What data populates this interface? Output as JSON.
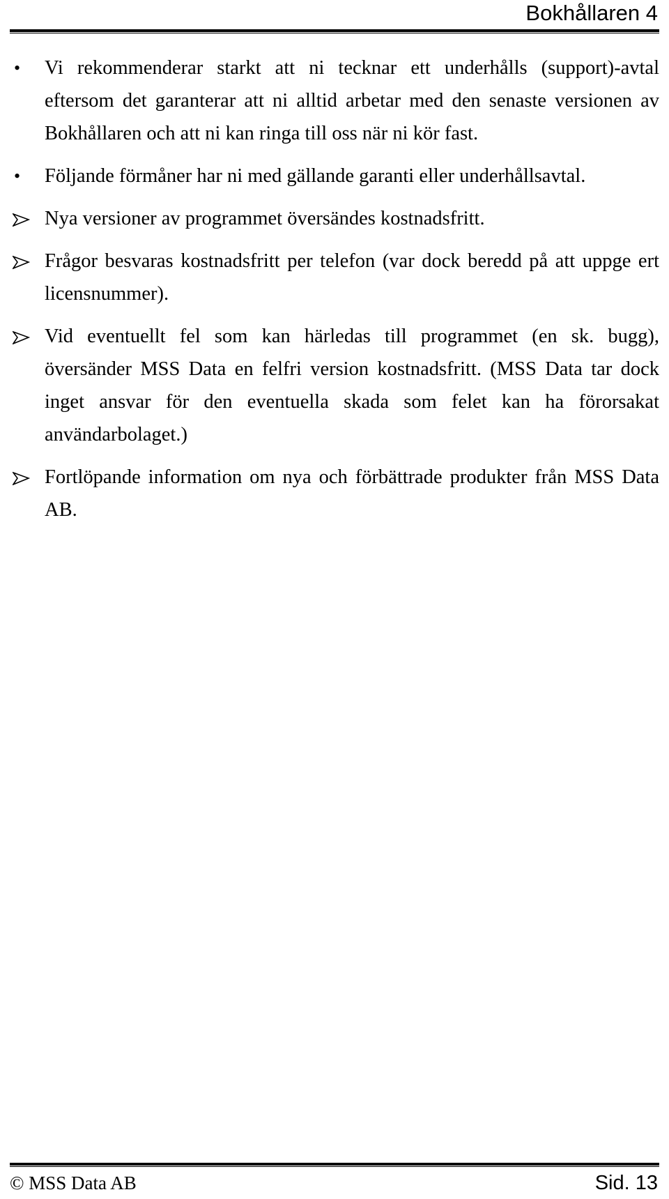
{
  "header": {
    "title": "Bokhållaren 4"
  },
  "content": {
    "items": [
      {
        "marker": "bullet",
        "marker_glyph": "•",
        "text": "Vi rekommenderar starkt att ni tecknar ett underhålls (support)-avtal eftersom det garanterar att ni alltid arbetar med den senaste versionen av Bokhållaren och att ni kan ringa till oss när ni kör fast."
      },
      {
        "marker": "bullet",
        "marker_glyph": "•",
        "text": "Följande förmåner har ni med gällande garanti eller underhållsavtal."
      },
      {
        "marker": "arrow",
        "marker_glyph": "➢",
        "text": "Nya versioner av programmet översändes kostnadsfritt."
      },
      {
        "marker": "arrow",
        "marker_glyph": "➢",
        "text": "Frågor besvaras kostnadsfritt per telefon (var dock beredd på att uppge ert licensnummer)."
      },
      {
        "marker": "arrow",
        "marker_glyph": "➢",
        "text": "Vid eventuellt fel som kan härledas till programmet (en sk. bugg), översänder MSS Data en felfri version kostnadsfritt. (MSS Data tar dock inget ansvar för den eventuella skada som felet kan ha förorsakat användarbolaget.)"
      },
      {
        "marker": "arrow",
        "marker_glyph": "➢",
        "text": "Fortlöpande information om nya och förbättrade produkter från MSS Data AB."
      }
    ]
  },
  "footer": {
    "copyright": "© MSS Data AB",
    "page_label": "Sid. 13"
  },
  "colors": {
    "text": "#000000",
    "background": "#ffffff",
    "rule": "#000000"
  }
}
